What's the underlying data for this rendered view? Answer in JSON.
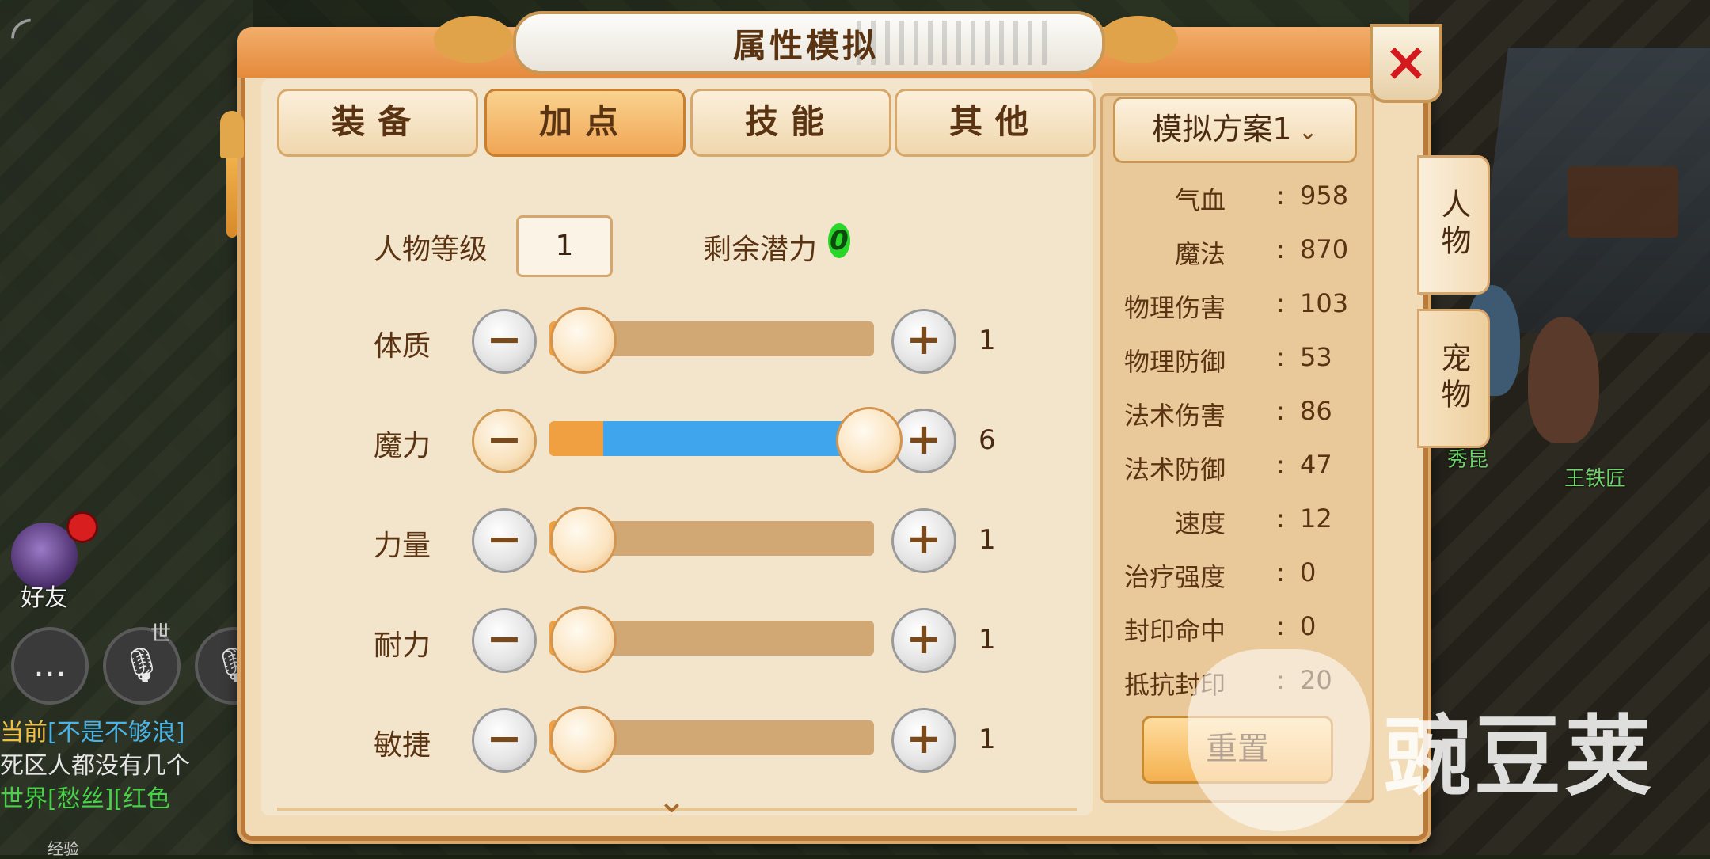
{
  "dialog": {
    "title": "属性模拟",
    "close_icon": "×",
    "tabs": [
      {
        "label": "装备",
        "active": false
      },
      {
        "label": "加点",
        "active": true
      },
      {
        "label": "技能",
        "active": false
      },
      {
        "label": "其他",
        "active": false
      }
    ],
    "side_tabs": [
      {
        "label": "人物",
        "active": true
      },
      {
        "label": "宠物",
        "active": false
      }
    ],
    "scheme": {
      "label": "模拟方案1",
      "chevron": "⌄"
    },
    "level_label": "人物等级",
    "level_value": "1",
    "potential_label": "剩余潜力",
    "potential_value": "0",
    "attributes": [
      {
        "name": "体质",
        "value": "1",
        "level": 0.0
      },
      {
        "name": "魔力",
        "value": "6",
        "level": 1.0
      },
      {
        "name": "力量",
        "value": "1",
        "level": 0.0
      },
      {
        "name": "耐力",
        "value": "1",
        "level": 0.0
      },
      {
        "name": "敏捷",
        "value": "1",
        "level": 0.0
      }
    ],
    "minus_symbol": "−",
    "plus_symbol": "+",
    "stats": [
      {
        "name": "气血",
        "sep": ":",
        "value": "958"
      },
      {
        "name": "魔法",
        "sep": ":",
        "value": "870"
      },
      {
        "name": "物理伤害",
        "sep": ":",
        "value": "103"
      },
      {
        "name": "物理防御",
        "sep": ":",
        "value": "53"
      },
      {
        "name": "法术伤害",
        "sep": ":",
        "value": "86"
      },
      {
        "name": "法术防御",
        "sep": ":",
        "value": "47"
      },
      {
        "name": "速度",
        "sep": ":",
        "value": "12"
      },
      {
        "name": "治疗强度",
        "sep": ":",
        "value": "0"
      },
      {
        "name": "封印命中",
        "sep": ":",
        "value": "0"
      },
      {
        "name": "抵抗封印",
        "sep": ":",
        "value": "20"
      }
    ],
    "reset_label": "重置",
    "scroll_icon": "⌄"
  },
  "background": {
    "back_icon": "◜",
    "friend_label": "好友",
    "chat_tag": "世",
    "chat_icons": [
      "chat-bubble-icon",
      "microphone-icon",
      "microphone-icon"
    ],
    "chat_lines": [
      {
        "prefix": "当前",
        "text": "[不是不够浪]"
      },
      {
        "prefix": "",
        "text": "死区人都没有几个"
      },
      {
        "prefix": "世界",
        "text": "[愁丝][红色"
      }
    ],
    "exp_label": "经验",
    "npc_names": [
      "秀昆",
      "王铁匠"
    ]
  },
  "watermark": {
    "text": "豌豆荚"
  },
  "colors": {
    "accent_orange": "#f0a040",
    "slider_blue": "#3fa5ec",
    "close_red": "#d4191e",
    "potential_green": "#2bd62b"
  }
}
